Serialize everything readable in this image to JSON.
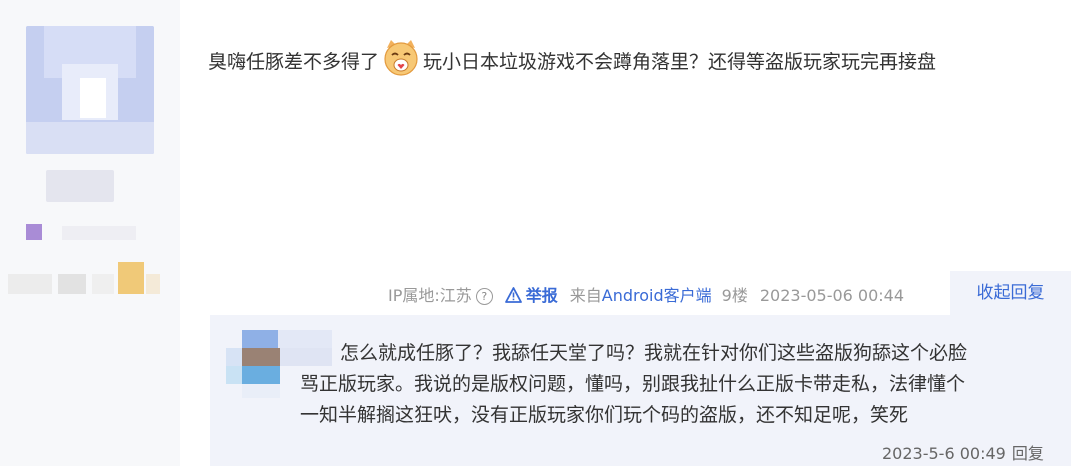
{
  "post": {
    "text_before_emoji": "臭嗨任豚差不多得了",
    "emoji_name": "laughing-cat-emoji",
    "text_after_emoji": "玩小日本垃圾游戏不会蹲角落里？还得等盗版玩家玩完再接盘"
  },
  "meta": {
    "ip_location": "IP属地:江苏",
    "help_glyph": "?",
    "report_label": "举报",
    "client_prefix": "来自",
    "client_name": "Android客户端",
    "floor": "9楼",
    "timestamp": "2023-05-06 00:44"
  },
  "collapse_label": "收起回复",
  "reply": {
    "text": "怎么就成任豚了？我舔任天堂了吗？我就在针对你们这些盗版狗舔这个必脸骂正版玩家。我说的是版权问题，懂吗，别跟我扯什么正版卡带走私，法律懂个一知半解搁这狂吠，没有正版玩家你们玩个码的盗版，还不知足呢，笑死",
    "line1": "怎么就成任豚了？我舔任天堂了吗？我就在针对你们这些盗版狗舔这个必脸",
    "line2": "骂正版玩家。我说的是版权问题，懂吗，别跟我扯什么正版卡带走私，法律懂个",
    "line3": "一知半解搁这狂吠，没有正版玩家你们玩个码的盗版，还不知足呢，笑死",
    "timestamp": "2023-5-6 00:49",
    "reply_label": "回复"
  },
  "colors": {
    "link_blue": "#3a6bd6",
    "meta_gray": "#999999",
    "reply_bg": "#f1f3fa",
    "sidebar_bg": "#f7f8fa"
  }
}
